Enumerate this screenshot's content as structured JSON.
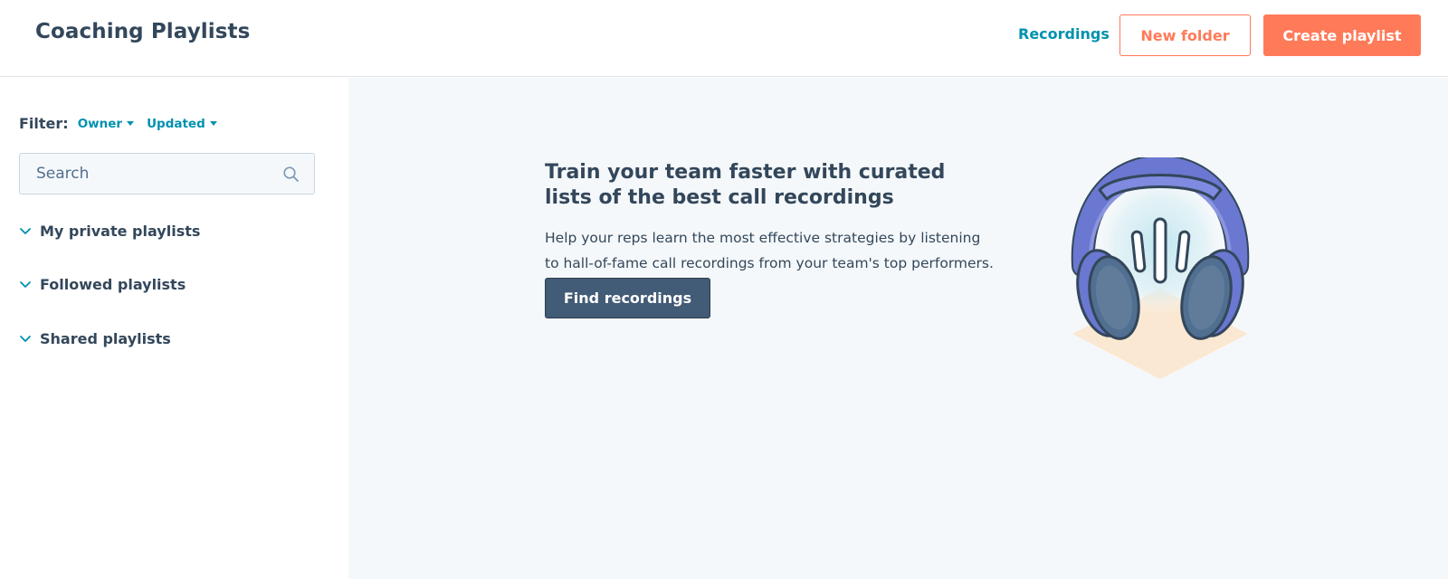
{
  "header": {
    "title": "Coaching Playlists",
    "recordings_link": "Recordings",
    "new_folder_label": "New folder",
    "create_playlist_label": "Create playlist"
  },
  "sidebar": {
    "filter_label": "Filter:",
    "filters": [
      "Owner",
      "Updated"
    ],
    "search": {
      "placeholder": "Search",
      "value": ""
    },
    "sections": [
      "My private playlists",
      "Followed playlists",
      "Shared playlists"
    ]
  },
  "main": {
    "headline": "Train your team faster with curated lists of the best call recordings",
    "description": "Help your reps learn the most effective strategies by listening to hall-of-fame call recordings from your team's top performers.",
    "cta_label": "Find recordings",
    "illustration": "headphones-illustration"
  },
  "colors": {
    "accent": "#ff7a59",
    "link": "#0091ae",
    "text": "#33475b",
    "cta_bg": "#425b76",
    "main_bg": "#f5f8fa"
  }
}
